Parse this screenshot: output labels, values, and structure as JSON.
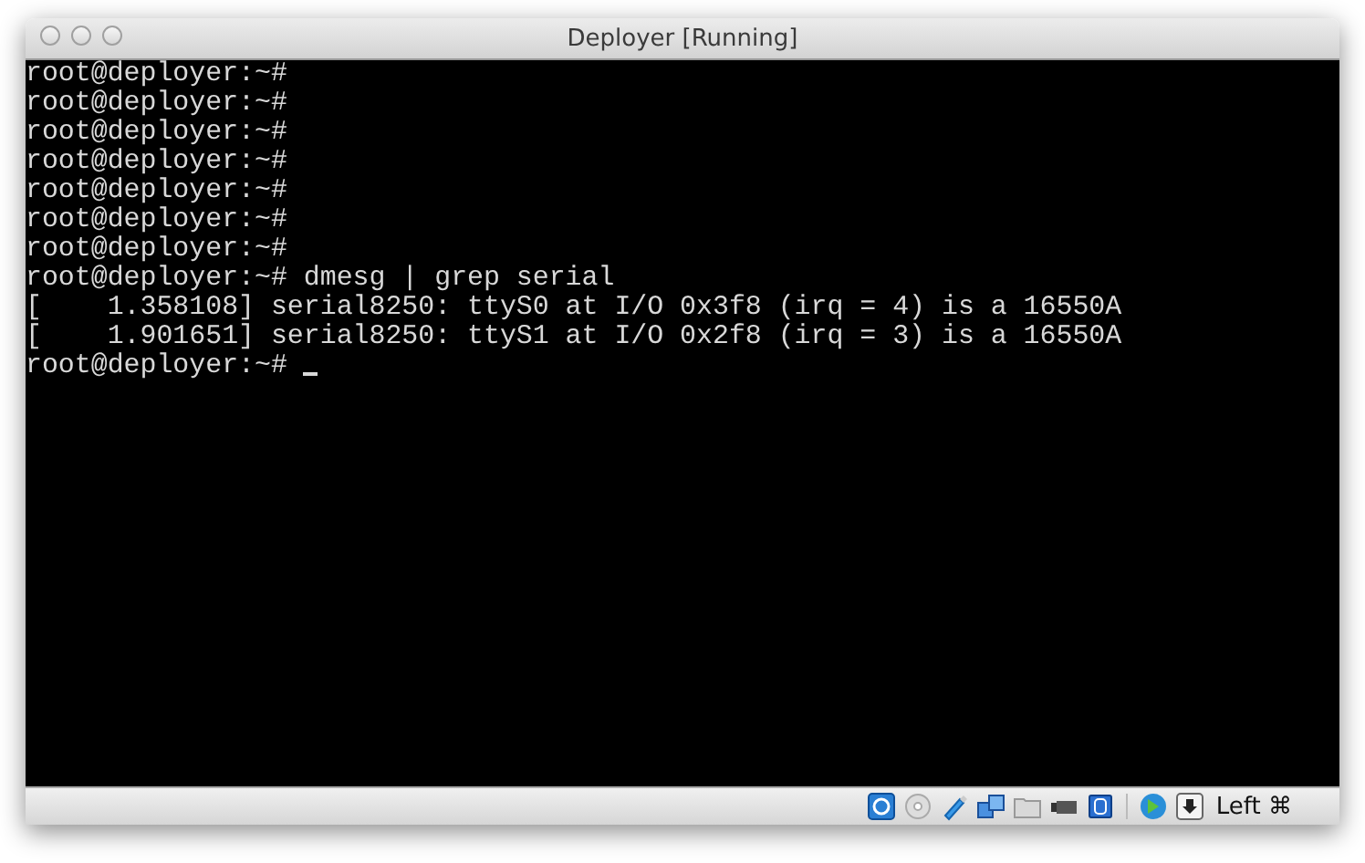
{
  "window": {
    "title": "Deployer [Running]"
  },
  "terminal": {
    "cursor": true,
    "lines": [
      "root@deployer:~#",
      "root@deployer:~#",
      "root@deployer:~#",
      "root@deployer:~#",
      "root@deployer:~#",
      "root@deployer:~#",
      "root@deployer:~#",
      "root@deployer:~# dmesg | grep serial",
      "[    1.358108] serial8250: ttyS0 at I/O 0x3f8 (irq = 4) is a 16550A",
      "[    1.901651] serial8250: ttyS1 at I/O 0x2f8 (irq = 3) is a 16550A",
      "root@deployer:~# "
    ]
  },
  "status_bar": {
    "host_key": "Left ⌘"
  }
}
